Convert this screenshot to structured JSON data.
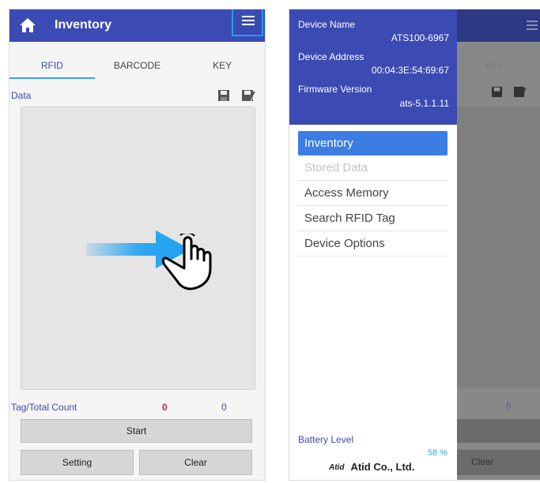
{
  "left_screen": {
    "title": "Inventory",
    "tabs": [
      "RFID",
      "BARCODE",
      "KEY"
    ],
    "data_label": "Data",
    "count_label": "Tag/Total Count",
    "tag_count": "0",
    "total_count": "0",
    "start_label": "Start",
    "setting_label": "Setting",
    "clear_label": "Clear"
  },
  "right_screen": {
    "device_name_label": "Device Name",
    "device_name": "ATS100-6967",
    "device_address_label": "Device Address",
    "device_address": "00:04:3E:54:69:67",
    "firmware_label": "Firmware Version",
    "firmware_version": "ats-5.1.1.11",
    "menu": [
      {
        "label": "Inventory",
        "state": "selected"
      },
      {
        "label": "Stored Data",
        "state": "disabled"
      },
      {
        "label": "Access Memory",
        "state": "normal"
      },
      {
        "label": "Search RFID Tag",
        "state": "normal"
      },
      {
        "label": "Device Options",
        "state": "normal"
      }
    ],
    "battery_label": "Battery Level",
    "battery_value": "58 %",
    "brand_mark": "Atid",
    "brand": "Atid Co., Ltd.",
    "bg_tab_key": "KEY",
    "bg_count": "0",
    "bg_clear": "Clear"
  },
  "colors": {
    "primary": "#3b4bb3",
    "accent": "#3b7de2",
    "highlight": "#1da1f2",
    "count_red": "#c62828"
  }
}
